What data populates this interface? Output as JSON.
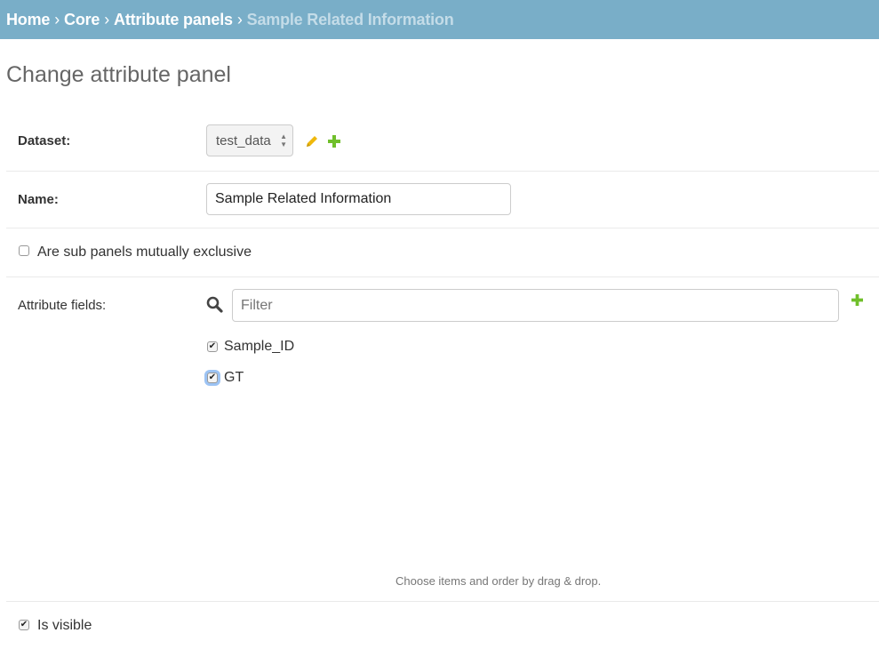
{
  "breadcrumbs": {
    "home": "Home",
    "core": "Core",
    "attribute_panels": "Attribute panels",
    "current": "Sample Related Information",
    "separator": "›"
  },
  "page_title": "Change attribute panel",
  "form": {
    "dataset": {
      "label": "Dataset:",
      "value": "test_data"
    },
    "name": {
      "label": "Name:",
      "value": "Sample Related Information"
    },
    "sub_panels_exclusive": {
      "label": "Are sub panels mutually exclusive",
      "checked": false
    },
    "attribute_fields": {
      "label": "Attribute fields:",
      "filter_placeholder": "Filter",
      "items": [
        {
          "label": "Sample_ID",
          "checked": true
        },
        {
          "label": "GT",
          "checked": true
        }
      ],
      "help": "Choose items and order by drag & drop."
    },
    "is_visible": {
      "label": "Is visible",
      "checked": true
    }
  },
  "colors": {
    "breadcrumb_bg": "#79aec8",
    "edit_icon": "#efb80b",
    "add_icon": "#70bf2b"
  },
  "icons": {
    "edit": "pencil-icon",
    "add": "plus-icon",
    "search": "magnifier-icon"
  }
}
